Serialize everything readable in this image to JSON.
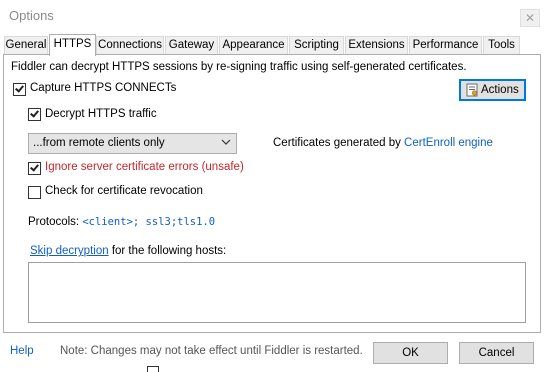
{
  "window": {
    "title": "Options"
  },
  "tabs": [
    {
      "label": "General",
      "active": false
    },
    {
      "label": "HTTPS",
      "active": true
    },
    {
      "label": "Connections",
      "active": false
    },
    {
      "label": "Gateway",
      "active": false
    },
    {
      "label": "Appearance",
      "active": false
    },
    {
      "label": "Scripting",
      "active": false
    },
    {
      "label": "Extensions",
      "active": false
    },
    {
      "label": "Performance",
      "active": false
    },
    {
      "label": "Tools",
      "active": false
    }
  ],
  "https": {
    "description": "Fiddler can decrypt HTTPS sessions by re-signing traffic using self-generated certificates.",
    "capture_label": "Capture HTTPS CONNECTs",
    "capture_checked": true,
    "actions_label": "Actions",
    "decrypt_label": "Decrypt HTTPS traffic",
    "decrypt_checked": true,
    "source_selected": "...from remote clients only",
    "cert_prefix": "Certificates generated by ",
    "cert_link": "CertEnroll engine",
    "ignore_label": "Ignore server certificate errors (unsafe)",
    "ignore_checked": true,
    "revocation_label": "Check for certificate revocation",
    "revocation_checked": false,
    "protocols_label": "Protocols: ",
    "protocols_value": "<client>; ssl3;tls1.0",
    "skip_link": "Skip decryption",
    "skip_suffix": " for the following hosts:",
    "hosts_value": ""
  },
  "footer": {
    "help": "Help",
    "note": "Note: Changes may not take effect until Fiddler is restarted.",
    "ok": "OK",
    "cancel": "Cancel"
  },
  "colors": {
    "link": "#1060c0",
    "danger": "#c1272d",
    "focus_border": "#0078d7"
  }
}
